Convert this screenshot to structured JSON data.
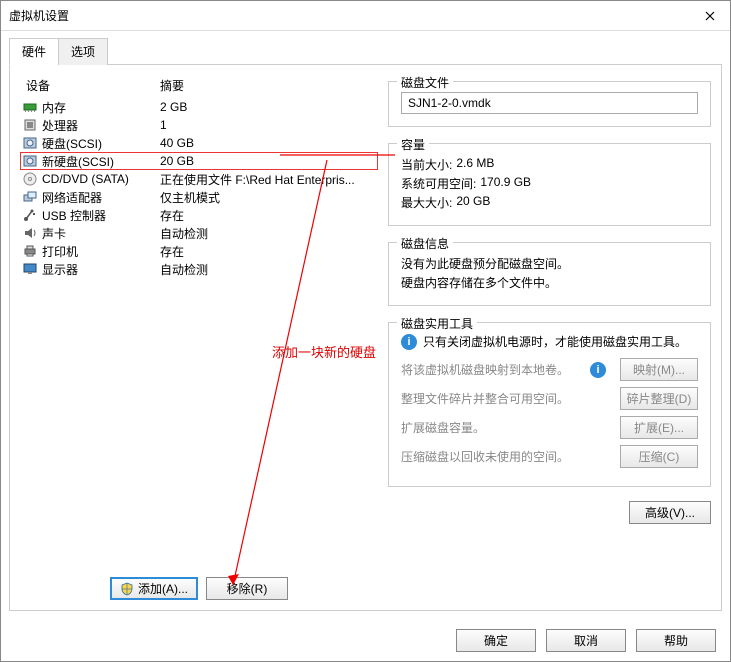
{
  "window": {
    "title": "虚拟机设置"
  },
  "tabs": {
    "hardware": "硬件",
    "options": "选项"
  },
  "headers": {
    "device": "设备",
    "summary": "摘要"
  },
  "devices": [
    {
      "icon": "memory",
      "name": "内存",
      "summary": "2 GB"
    },
    {
      "icon": "cpu",
      "name": "处理器",
      "summary": "1"
    },
    {
      "icon": "hdd",
      "name": "硬盘(SCSI)",
      "summary": "40 GB"
    },
    {
      "icon": "hdd",
      "name": "新硬盘(SCSI)",
      "summary": "20 GB",
      "selected": true
    },
    {
      "icon": "cd",
      "name": "CD/DVD (SATA)",
      "summary": "正在使用文件 F:\\Red Hat Enterpris..."
    },
    {
      "icon": "net",
      "name": "网络适配器",
      "summary": "仅主机模式"
    },
    {
      "icon": "usb",
      "name": "USB 控制器",
      "summary": "存在"
    },
    {
      "icon": "sound",
      "name": "声卡",
      "summary": "自动检测"
    },
    {
      "icon": "printer",
      "name": "打印机",
      "summary": "存在"
    },
    {
      "icon": "display",
      "name": "显示器",
      "summary": "自动检测"
    }
  ],
  "buttons": {
    "add": "添加(A)...",
    "remove": "移除(R)"
  },
  "disk_file": {
    "legend": "磁盘文件",
    "value": "SJN1-2-0.vmdk"
  },
  "capacity": {
    "legend": "容量",
    "current_size_k": "当前大小:",
    "current_size_v": "2.6 MB",
    "free_space_k": "系统可用空间:",
    "free_space_v": "170.9 GB",
    "max_size_k": "最大大小:",
    "max_size_v": "20 GB"
  },
  "disk_info": {
    "legend": "磁盘信息",
    "line1": "没有为此硬盘预分配磁盘空间。",
    "line2": "硬盘内容存储在多个文件中。"
  },
  "tools": {
    "legend": "磁盘实用工具",
    "warn": "只有关闭虚拟机电源时，才能使用磁盘实用工具。",
    "map_txt": "将该虚拟机磁盘映射到本地卷。",
    "map_btn": "映射(M)...",
    "defrag_txt": "整理文件碎片并整合可用空间。",
    "defrag_btn": "碎片整理(D)",
    "expand_txt": "扩展磁盘容量。",
    "expand_btn": "扩展(E)...",
    "compact_txt": "压缩磁盘以回收未使用的空间。",
    "compact_btn": "压缩(C)"
  },
  "advanced_btn": "高级(V)...",
  "footer": {
    "ok": "确定",
    "cancel": "取消",
    "help": "帮助"
  },
  "annotation": "添加一块新的硬盘"
}
